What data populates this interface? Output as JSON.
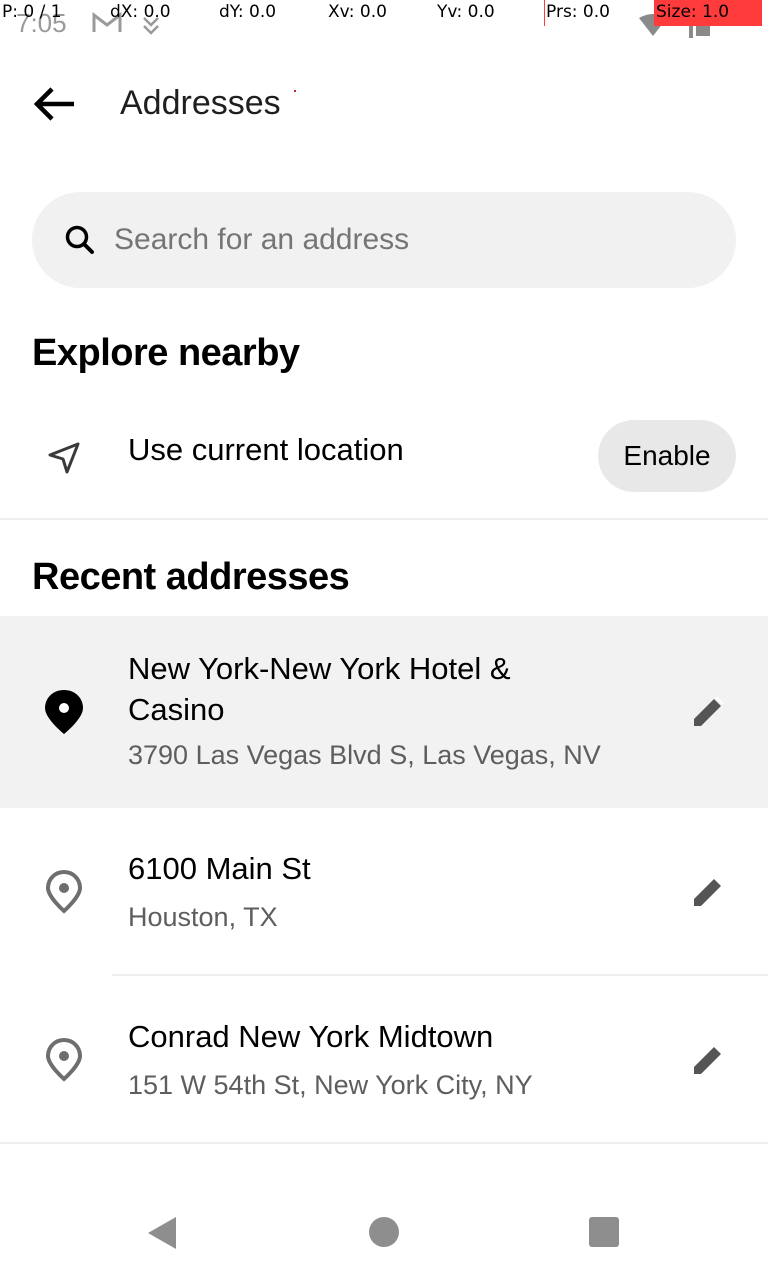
{
  "status_bar": {
    "time": "7:05",
    "icons": [
      "gmail-icon",
      "download-icon",
      "wifi-icon",
      "signal-icon",
      "battery-icon"
    ]
  },
  "debug_overlay": {
    "pointer": "P: 0 / 1",
    "dx": "dX: 0.0",
    "dy": "dY: 0.0",
    "xv": "Xv: 0.0",
    "yv": "Yv: 0.0",
    "prs": "Prs: 0.0",
    "size": "Size: 1.0"
  },
  "header": {
    "title": "Addresses",
    "back_icon": "arrow-left-icon"
  },
  "search": {
    "placeholder": "Search for an address",
    "value": ""
  },
  "explore": {
    "heading": "Explore nearby",
    "current_location_label": "Use current location",
    "enable_label": "Enable"
  },
  "recent": {
    "heading": "Recent addresses",
    "items": [
      {
        "name": "New York-New York Hotel & Casino",
        "address": "3790 Las Vegas Blvd S, Las Vegas, NV",
        "selected": true
      },
      {
        "name": "6100 Main St",
        "address": "Houston, TX",
        "selected": false
      },
      {
        "name": "Conrad New York Midtown",
        "address": "151 W 54th St, New York City, NY",
        "selected": false
      }
    ]
  },
  "colors": {
    "search_bg": "#f1f1f1",
    "selected_row_bg": "#f2f2f2",
    "enable_bg": "#e8e8e8",
    "secondary_text": "#5e5e5e"
  }
}
